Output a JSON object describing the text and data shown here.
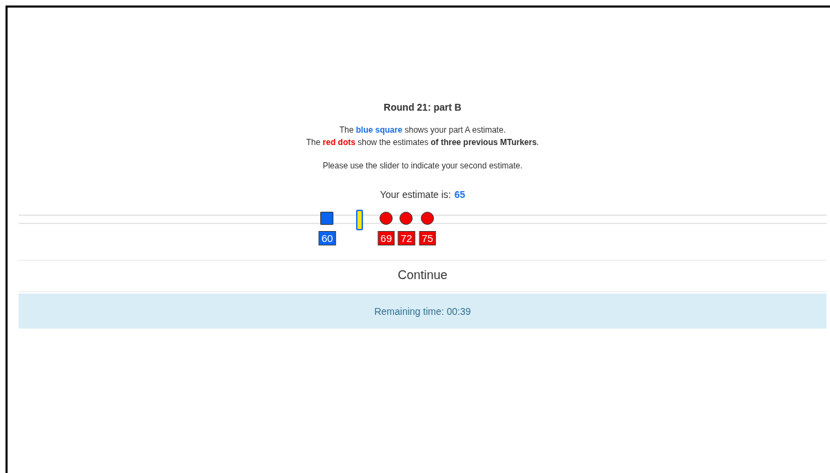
{
  "title": "Round 21: part B",
  "instructions": [
    [
      {
        "kind": "plain",
        "text": "The "
      },
      {
        "kind": "blue",
        "text": "blue square"
      },
      {
        "kind": "plain",
        "text": " shows your part A estimate."
      }
    ],
    [
      {
        "kind": "plain",
        "text": "The "
      },
      {
        "kind": "red",
        "text": "red dots"
      },
      {
        "kind": "plain",
        "text": " show the estimates "
      },
      {
        "kind": "bold",
        "text": "of three previous MTurkers"
      },
      {
        "kind": "plain",
        "text": "."
      }
    ]
  ],
  "prompt": "Please use the slider to indicate your second estimate.",
  "estimate": {
    "label": "Your estimate is:",
    "value": "65"
  },
  "slider": {
    "level": 0.422,
    "markers": [
      {
        "kind": "square",
        "label": "60",
        "level": 0.382
      },
      {
        "kind": "dot",
        "label": "69",
        "level": 0.455
      },
      {
        "kind": "dot",
        "label": "72",
        "level": 0.48
      },
      {
        "kind": "dot",
        "label": "75",
        "level": 0.506
      }
    ]
  },
  "continue_button": "Continue",
  "timer": "Remaining time: 00:39"
}
